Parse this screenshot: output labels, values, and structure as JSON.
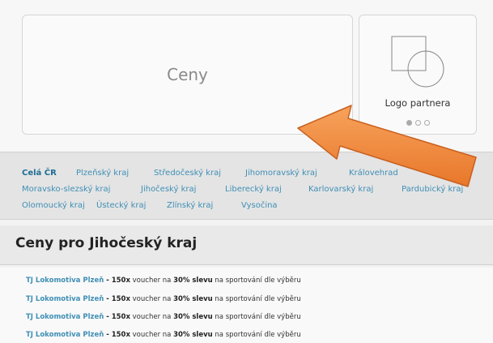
{
  "hero": {
    "ceny_label": "Ceny",
    "partner_label": "Logo partnera",
    "logo_icon": "shapes-logo-placeholder-icon"
  },
  "regions": {
    "row1": [
      "Celá ČR",
      "Plzeňský kraj",
      "Středočeský kraj",
      "Jihomoravský kraj",
      "Královehrad"
    ],
    "row2": [
      "Moravsko-slezský kraj",
      "Jihočeský kraj",
      "Liberecký kraj",
      "Karlovarský kraj",
      "Pardubický kraj"
    ],
    "row3": [
      "Olomoucký kraj",
      "Ústecký kraj",
      "Zlínský kraj",
      "Vysočina"
    ]
  },
  "heading": "Ceny pro Jihočeský kraj",
  "items": [
    {
      "club": "TJ Lokomotiva Plzeň",
      "sep": " - ",
      "count": "150x",
      "t1": " voucher na ",
      "discount": "30% slevu",
      "t2": " na sportování dle výběru"
    },
    {
      "club": "TJ Lokomotiva Plzeň",
      "sep": " - ",
      "count": "150x",
      "t1": " voucher na ",
      "discount": "30% slevu",
      "t2": " na sportování dle výběru"
    },
    {
      "club": "TJ Lokomotiva Plzeň",
      "sep": " - ",
      "count": "150x",
      "t1": " voucher na ",
      "discount": "30% slevu",
      "t2": " na sportování dle výběru"
    },
    {
      "club": "TJ Lokomotiva Plzeň",
      "sep": " - ",
      "count": "150x",
      "t1": " voucher na ",
      "discount": "30% slevu",
      "t2": " na sportování dle výběru"
    }
  ],
  "colors": {
    "accent_link": "#3f8fb5",
    "arrow_fill": "#f08a3c"
  },
  "annotation": "orange-pointer-arrow-icon"
}
